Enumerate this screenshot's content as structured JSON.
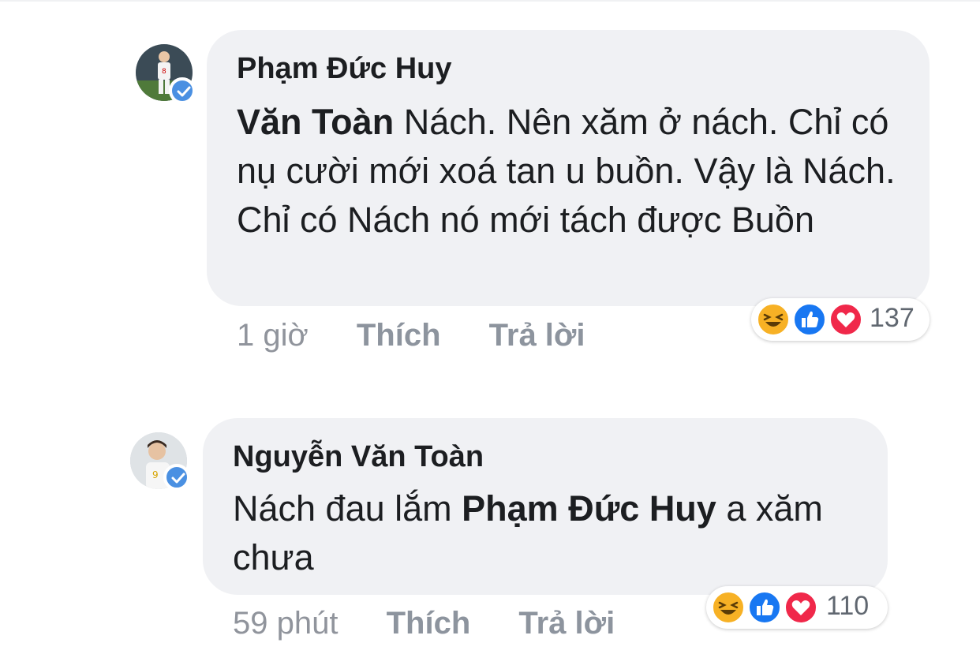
{
  "comments": [
    {
      "author": "Phạm Đức Huy",
      "mention": "Văn Toàn",
      "text_after_mention": " Nách. Nên xăm ở nách. Chỉ có nụ cười mới xoá tan u buồn. Vậy là Nách. Chỉ có Nách nó mới tách được Buồn",
      "time": "1 giờ",
      "like_label": "Thích",
      "reply_label": "Trả lời",
      "reaction_count": "137",
      "reactions": [
        "haha-icon",
        "like-icon",
        "love-icon"
      ]
    },
    {
      "author": "Nguyễn Văn Toàn",
      "text_before_mention": "Nách đau lắm ",
      "mention": "Phạm Đức Huy",
      "text_after_mention": " a xăm chưa",
      "time": "59 phút",
      "like_label": "Thích",
      "reply_label": "Trả lời",
      "reaction_count": "110",
      "reactions": [
        "haha-icon",
        "like-icon",
        "love-icon"
      ]
    }
  ],
  "colors": {
    "bubble": "#f0f1f4",
    "verified": "#4a90e2",
    "like": "#1877f2",
    "love": "#f0284a",
    "haha": "#f7b125",
    "meta_text": "#90949c"
  }
}
